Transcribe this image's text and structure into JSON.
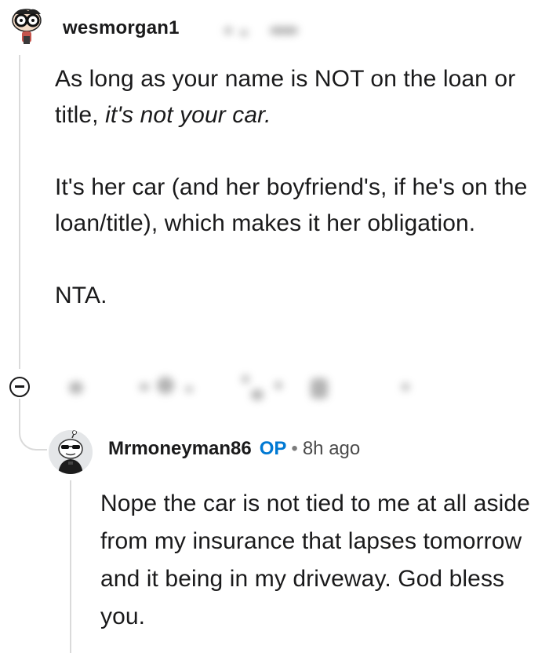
{
  "top_comment": {
    "username": "wesmorgan1",
    "avatar_icon": "glasses-character-avatar-icon",
    "paragraphs": [
      {
        "text_before": "As long as your name is NOT on the loan or title, ",
        "emphasis": "it's not your car."
      },
      {
        "text": "It's her car (and her boyfriend's, if he's on the loan/title), which makes it her obligation."
      },
      {
        "text": "NTA."
      }
    ]
  },
  "collapse": {
    "icon": "collapse-minus-icon"
  },
  "reply": {
    "username": "Mrmoneyman86",
    "badge": "OP",
    "separator": "•",
    "time": "8h ago",
    "avatar_icon": "snoo-avatar-icon",
    "body": "Nope the car is not tied to me at all aside from my insurance that lapses tomorrow and it being in my driveway. God bless you."
  },
  "colors": {
    "op_badge": "#0079d3",
    "thread_line": "#dadada",
    "text": "#1a1a1b"
  }
}
